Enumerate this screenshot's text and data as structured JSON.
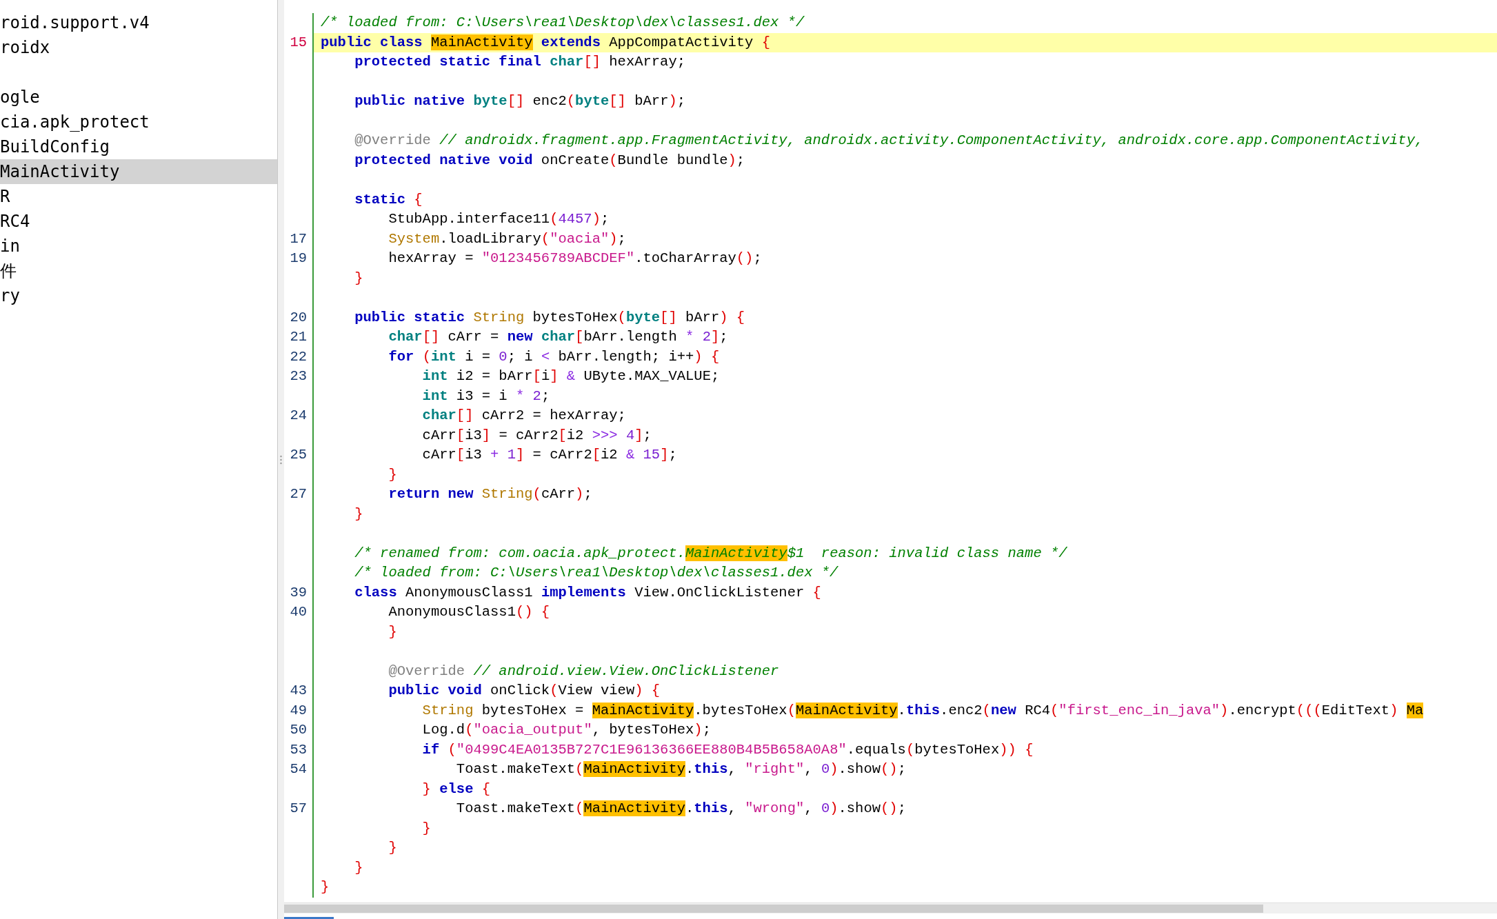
{
  "sidebar": {
    "items": [
      {
        "label": "roid.support.v4",
        "selected": false
      },
      {
        "label": "roidx",
        "selected": false
      },
      {
        "label": "ogle",
        "selected": false,
        "blank_before": true
      },
      {
        "label": "cia.apk_protect",
        "selected": false
      },
      {
        "label": "BuildConfig",
        "selected": false
      },
      {
        "label": "MainActivity",
        "selected": true
      },
      {
        "label": "R",
        "selected": false
      },
      {
        "label": "RC4",
        "selected": false
      },
      {
        "label": "in",
        "selected": false
      },
      {
        "label": "件",
        "selected": false
      },
      {
        "label": "ry",
        "selected": false
      }
    ]
  },
  "code_lines": [
    {
      "current": false,
      "tokens": [
        {
          "kind": "comment",
          "text": "/* loaded from: C:\\Users\\rea1\\Desktop\\dex\\classes1.dex */"
        }
      ]
    },
    {
      "number": "15",
      "current": true,
      "tokens": [
        {
          "kind": "keyword",
          "text": "public class "
        },
        {
          "kind": "highlight",
          "text": "MainActivity"
        },
        {
          "kind": "keyword",
          "text": " extends"
        },
        {
          "kind": "plain",
          "text": " AppCompatActivity "
        },
        {
          "kind": "punct",
          "text": "{"
        }
      ]
    },
    {
      "current": false,
      "tokens": [
        {
          "kind": "keyword",
          "text": "    protected static final "
        },
        {
          "kind": "type",
          "text": "char"
        },
        {
          "kind": "punct",
          "text": "[]"
        },
        {
          "kind": "plain",
          "text": " hexArray;"
        }
      ]
    },
    {
      "current": false,
      "blank_before": true,
      "tokens": [
        {
          "kind": "keyword",
          "text": "    public native "
        },
        {
          "kind": "type",
          "text": "byte"
        },
        {
          "kind": "punct",
          "text": "[]"
        },
        {
          "kind": "plain",
          "text": " enc2"
        },
        {
          "kind": "punct",
          "text": "("
        },
        {
          "kind": "type",
          "text": "byte"
        },
        {
          "kind": "punct",
          "text": "[]"
        },
        {
          "kind": "plain",
          "text": " bArr"
        },
        {
          "kind": "punct",
          "text": ")"
        },
        {
          "kind": "plain",
          "text": ";"
        }
      ]
    },
    {
      "current": false,
      "blank_before": true,
      "tokens": [
        {
          "kind": "annotation",
          "text": "    @Override"
        },
        {
          "kind": "comment",
          "text": " // androidx.fragment.app.FragmentActivity, androidx.activity.ComponentActivity, androidx.core.app.ComponentActivity,"
        }
      ]
    },
    {
      "current": false,
      "tokens": [
        {
          "kind": "keyword",
          "text": "    protected native void "
        },
        {
          "kind": "plain",
          "text": "onCreate"
        },
        {
          "kind": "punct",
          "text": "("
        },
        {
          "kind": "plain",
          "text": "Bundle bundle"
        },
        {
          "kind": "punct",
          "text": ")"
        },
        {
          "kind": "plain",
          "text": ";"
        }
      ]
    },
    {
      "current": false,
      "blank_before": true,
      "tokens": [
        {
          "kind": "keyword",
          "text": "    static "
        },
        {
          "kind": "punct",
          "text": "{"
        }
      ]
    },
    {
      "current": false,
      "tokens": [
        {
          "kind": "plain",
          "text": "        StubApp.interface11"
        },
        {
          "kind": "punct",
          "text": "("
        },
        {
          "kind": "number",
          "text": "4457"
        },
        {
          "kind": "punct",
          "text": ")"
        },
        {
          "kind": "plain",
          "text": ";"
        }
      ]
    },
    {
      "number": "17",
      "current": false,
      "tokens": [
        {
          "kind": "class",
          "text": "        System"
        },
        {
          "kind": "plain",
          "text": ".loadLibrary"
        },
        {
          "kind": "punct",
          "text": "("
        },
        {
          "kind": "string",
          "text": "\"oacia\""
        },
        {
          "kind": "punct",
          "text": ")"
        },
        {
          "kind": "plain",
          "text": ";"
        }
      ]
    },
    {
      "number": "19",
      "current": false,
      "tokens": [
        {
          "kind": "plain",
          "text": "        hexArray = "
        },
        {
          "kind": "string",
          "text": "\"0123456789ABCDEF\""
        },
        {
          "kind": "plain",
          "text": ".toCharArray"
        },
        {
          "kind": "punct",
          "text": "()"
        },
        {
          "kind": "plain",
          "text": ";"
        }
      ]
    },
    {
      "current": false,
      "tokens": [
        {
          "kind": "punct",
          "text": "    }"
        }
      ]
    },
    {
      "number": "20",
      "current": false,
      "blank_before": true,
      "tokens": [
        {
          "kind": "keyword",
          "text": "    public static "
        },
        {
          "kind": "class",
          "text": "String"
        },
        {
          "kind": "plain",
          "text": " bytesToHex"
        },
        {
          "kind": "punct",
          "text": "("
        },
        {
          "kind": "type",
          "text": "byte"
        },
        {
          "kind": "punct",
          "text": "[]"
        },
        {
          "kind": "plain",
          "text": " bArr"
        },
        {
          "kind": "punct",
          "text": ")"
        },
        {
          "kind": "punct",
          "text": " {"
        }
      ]
    },
    {
      "number": "21",
      "current": false,
      "tokens": [
        {
          "kind": "type",
          "text": "        char"
        },
        {
          "kind": "punct",
          "text": "[]"
        },
        {
          "kind": "plain",
          "text": " cArr = "
        },
        {
          "kind": "keyword",
          "text": "new "
        },
        {
          "kind": "type",
          "text": "char"
        },
        {
          "kind": "punct",
          "text": "["
        },
        {
          "kind": "plain",
          "text": "bArr.length "
        },
        {
          "kind": "operator",
          "text": "*"
        },
        {
          "kind": "number",
          "text": " 2"
        },
        {
          "kind": "punct",
          "text": "]"
        },
        {
          "kind": "plain",
          "text": ";"
        }
      ]
    },
    {
      "number": "22",
      "current": false,
      "tokens": [
        {
          "kind": "keyword",
          "text": "        for "
        },
        {
          "kind": "punct",
          "text": "("
        },
        {
          "kind": "type",
          "text": "int"
        },
        {
          "kind": "plain",
          "text": " i = "
        },
        {
          "kind": "number",
          "text": "0"
        },
        {
          "kind": "plain",
          "text": "; i "
        },
        {
          "kind": "operator",
          "text": "<"
        },
        {
          "kind": "plain",
          "text": " bArr.length; i++"
        },
        {
          "kind": "punct",
          "text": ")"
        },
        {
          "kind": "punct",
          "text": " {"
        }
      ]
    },
    {
      "number": "23",
      "current": false,
      "tokens": [
        {
          "kind": "type",
          "text": "            int"
        },
        {
          "kind": "plain",
          "text": " i2 = bArr"
        },
        {
          "kind": "punct",
          "text": "["
        },
        {
          "kind": "plain",
          "text": "i"
        },
        {
          "kind": "punct",
          "text": "]"
        },
        {
          "kind": "operator",
          "text": " &"
        },
        {
          "kind": "plain",
          "text": " UByte.MAX_VALUE;"
        }
      ]
    },
    {
      "current": false,
      "tokens": [
        {
          "kind": "type",
          "text": "            int"
        },
        {
          "kind": "plain",
          "text": " i3 = i "
        },
        {
          "kind": "operator",
          "text": "*"
        },
        {
          "kind": "number",
          "text": " 2"
        },
        {
          "kind": "plain",
          "text": ";"
        }
      ]
    },
    {
      "number": "24",
      "current": false,
      "tokens": [
        {
          "kind": "type",
          "text": "            char"
        },
        {
          "kind": "punct",
          "text": "[]"
        },
        {
          "kind": "plain",
          "text": " cArr2 = hexArray;"
        }
      ]
    },
    {
      "current": false,
      "tokens": [
        {
          "kind": "plain",
          "text": "            cArr"
        },
        {
          "kind": "punct",
          "text": "["
        },
        {
          "kind": "plain",
          "text": "i3"
        },
        {
          "kind": "punct",
          "text": "]"
        },
        {
          "kind": "plain",
          "text": " = cArr2"
        },
        {
          "kind": "punct",
          "text": "["
        },
        {
          "kind": "plain",
          "text": "i2 "
        },
        {
          "kind": "operator",
          "text": ">>>"
        },
        {
          "kind": "number",
          "text": " 4"
        },
        {
          "kind": "punct",
          "text": "]"
        },
        {
          "kind": "plain",
          "text": ";"
        }
      ]
    },
    {
      "number": "25",
      "current": false,
      "tokens": [
        {
          "kind": "plain",
          "text": "            cArr"
        },
        {
          "kind": "punct",
          "text": "["
        },
        {
          "kind": "plain",
          "text": "i3 "
        },
        {
          "kind": "operator",
          "text": "+"
        },
        {
          "kind": "number",
          "text": " 1"
        },
        {
          "kind": "punct",
          "text": "]"
        },
        {
          "kind": "plain",
          "text": " = cArr2"
        },
        {
          "kind": "punct",
          "text": "["
        },
        {
          "kind": "plain",
          "text": "i2 "
        },
        {
          "kind": "operator",
          "text": "&"
        },
        {
          "kind": "number",
          "text": " 15"
        },
        {
          "kind": "punct",
          "text": "]"
        },
        {
          "kind": "plain",
          "text": ";"
        }
      ]
    },
    {
      "current": false,
      "tokens": [
        {
          "kind": "punct",
          "text": "        }"
        }
      ]
    },
    {
      "number": "27",
      "current": false,
      "tokens": [
        {
          "kind": "keyword",
          "text": "        return new "
        },
        {
          "kind": "class",
          "text": "String"
        },
        {
          "kind": "punct",
          "text": "("
        },
        {
          "kind": "plain",
          "text": "cArr"
        },
        {
          "kind": "punct",
          "text": ")"
        },
        {
          "kind": "plain",
          "text": ";"
        }
      ]
    },
    {
      "current": false,
      "tokens": [
        {
          "kind": "punct",
          "text": "    }"
        }
      ]
    },
    {
      "current": false,
      "blank_before": true,
      "tokens": [
        {
          "kind": "comment",
          "text": "    /* renamed from: com.oacia.apk_protect."
        },
        {
          "kind": "comment-highlight",
          "text": "MainActivity"
        },
        {
          "kind": "comment",
          "text": "$1  reason: invalid class name */"
        }
      ]
    },
    {
      "current": false,
      "tokens": [
        {
          "kind": "comment",
          "text": "    /* loaded from: C:\\Users\\rea1\\Desktop\\dex\\classes1.dex */"
        }
      ]
    },
    {
      "number": "39",
      "current": false,
      "tokens": [
        {
          "kind": "keyword",
          "text": "    class "
        },
        {
          "kind": "plain",
          "text": "AnonymousClass1 "
        },
        {
          "kind": "keyword",
          "text": "implements "
        },
        {
          "kind": "plain",
          "text": "View.OnClickListener "
        },
        {
          "kind": "punct",
          "text": "{"
        }
      ]
    },
    {
      "number": "40",
      "current": false,
      "tokens": [
        {
          "kind": "plain",
          "text": "        AnonymousClass1"
        },
        {
          "kind": "punct",
          "text": "()"
        },
        {
          "kind": "punct",
          "text": " {"
        }
      ]
    },
    {
      "current": false,
      "tokens": [
        {
          "kind": "punct",
          "text": "        }"
        }
      ]
    },
    {
      "current": false,
      "blank_before": true,
      "tokens": [
        {
          "kind": "annotation",
          "text": "        @Override"
        },
        {
          "kind": "comment",
          "text": " // android.view.View.OnClickListener"
        }
      ]
    },
    {
      "number": "43",
      "current": false,
      "tokens": [
        {
          "kind": "keyword",
          "text": "        public void "
        },
        {
          "kind": "plain",
          "text": "onClick"
        },
        {
          "kind": "punct",
          "text": "("
        },
        {
          "kind": "plain",
          "text": "View view"
        },
        {
          "kind": "punct",
          "text": ")"
        },
        {
          "kind": "punct",
          "text": " {"
        }
      ]
    },
    {
      "number": "49",
      "current": false,
      "tokens": [
        {
          "kind": "class",
          "text": "            String"
        },
        {
          "kind": "plain",
          "text": " bytesToHex = "
        },
        {
          "kind": "highlight",
          "text": "MainActivity"
        },
        {
          "kind": "plain",
          "text": ".bytesToHex"
        },
        {
          "kind": "punct",
          "text": "("
        },
        {
          "kind": "highlight",
          "text": "MainActivity"
        },
        {
          "kind": "plain",
          "text": "."
        },
        {
          "kind": "keyword",
          "text": "this"
        },
        {
          "kind": "plain",
          "text": ".enc2"
        },
        {
          "kind": "punct",
          "text": "("
        },
        {
          "kind": "keyword",
          "text": "new "
        },
        {
          "kind": "plain",
          "text": "RC4"
        },
        {
          "kind": "punct",
          "text": "("
        },
        {
          "kind": "string",
          "text": "\"first_enc_in_java\""
        },
        {
          "kind": "punct",
          "text": ")"
        },
        {
          "kind": "plain",
          "text": ".encrypt"
        },
        {
          "kind": "punct",
          "text": "((("
        },
        {
          "kind": "plain",
          "text": "EditText"
        },
        {
          "kind": "punct",
          "text": ") "
        },
        {
          "kind": "highlight",
          "text": "Ma"
        }
      ]
    },
    {
      "number": "50",
      "current": false,
      "tokens": [
        {
          "kind": "plain",
          "text": "            Log.d"
        },
        {
          "kind": "punct",
          "text": "("
        },
        {
          "kind": "string",
          "text": "\"oacia_output\""
        },
        {
          "kind": "plain",
          "text": ", bytesToHex"
        },
        {
          "kind": "punct",
          "text": ")"
        },
        {
          "kind": "plain",
          "text": ";"
        }
      ]
    },
    {
      "number": "53",
      "current": false,
      "tokens": [
        {
          "kind": "keyword",
          "text": "            if "
        },
        {
          "kind": "punct",
          "text": "("
        },
        {
          "kind": "string",
          "text": "\"0499C4EA0135B727C1E96136366EE880B4B5B658A0A8\""
        },
        {
          "kind": "plain",
          "text": ".equals"
        },
        {
          "kind": "punct",
          "text": "("
        },
        {
          "kind": "plain",
          "text": "bytesToHex"
        },
        {
          "kind": "punct",
          "text": "))"
        },
        {
          "kind": "punct",
          "text": " {"
        }
      ]
    },
    {
      "number": "54",
      "current": false,
      "tokens": [
        {
          "kind": "plain",
          "text": "                Toast.makeText"
        },
        {
          "kind": "punct",
          "text": "("
        },
        {
          "kind": "highlight",
          "text": "MainActivity"
        },
        {
          "kind": "plain",
          "text": "."
        },
        {
          "kind": "keyword",
          "text": "this"
        },
        {
          "kind": "plain",
          "text": ", "
        },
        {
          "kind": "string",
          "text": "\"right\""
        },
        {
          "kind": "plain",
          "text": ", "
        },
        {
          "kind": "number",
          "text": "0"
        },
        {
          "kind": "punct",
          "text": ")"
        },
        {
          "kind": "plain",
          "text": ".show"
        },
        {
          "kind": "punct",
          "text": "()"
        },
        {
          "kind": "plain",
          "text": ";"
        }
      ]
    },
    {
      "current": false,
      "tokens": [
        {
          "kind": "punct",
          "text": "            }"
        },
        {
          "kind": "keyword",
          "text": " else "
        },
        {
          "kind": "punct",
          "text": "{"
        }
      ]
    },
    {
      "number": "57",
      "current": false,
      "tokens": [
        {
          "kind": "plain",
          "text": "                Toast.makeText"
        },
        {
          "kind": "punct",
          "text": "("
        },
        {
          "kind": "highlight",
          "text": "MainActivity"
        },
        {
          "kind": "plain",
          "text": "."
        },
        {
          "kind": "keyword",
          "text": "this"
        },
        {
          "kind": "plain",
          "text": ", "
        },
        {
          "kind": "string",
          "text": "\"wrong\""
        },
        {
          "kind": "plain",
          "text": ", "
        },
        {
          "kind": "number",
          "text": "0"
        },
        {
          "kind": "punct",
          "text": ")"
        },
        {
          "kind": "plain",
          "text": ".show"
        },
        {
          "kind": "punct",
          "text": "()"
        },
        {
          "kind": "plain",
          "text": ";"
        }
      ]
    },
    {
      "current": false,
      "tokens": [
        {
          "kind": "punct",
          "text": "            }"
        }
      ]
    },
    {
      "current": false,
      "tokens": [
        {
          "kind": "punct",
          "text": "        }"
        }
      ]
    },
    {
      "current": false,
      "tokens": [
        {
          "kind": "punct",
          "text": "    }"
        }
      ]
    },
    {
      "current": false,
      "tokens": [
        {
          "kind": "punct",
          "text": "}"
        }
      ]
    }
  ]
}
